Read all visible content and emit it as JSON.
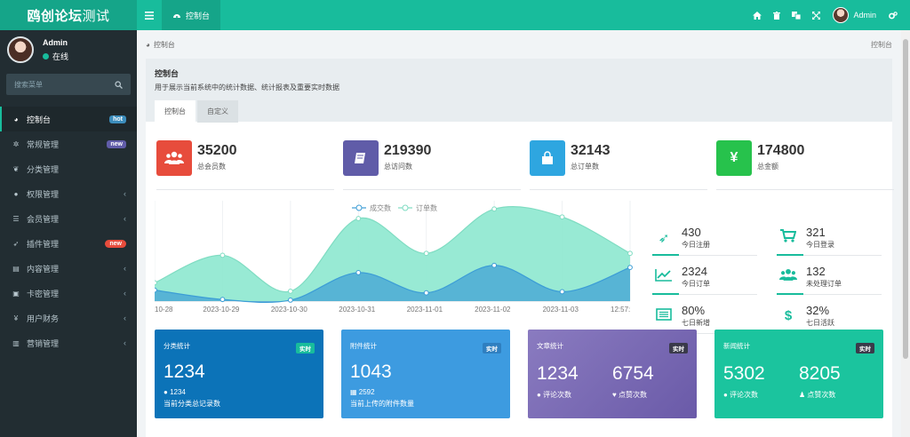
{
  "app": {
    "brand_bold": "鸥创论坛",
    "brand_thin": "测试"
  },
  "header": {
    "tab_label": "控制台",
    "user_name": "Admin",
    "icons": [
      "home-icon",
      "trash-icon",
      "translate-icon",
      "fullscreen-icon",
      "gears-icon"
    ]
  },
  "sidebar": {
    "user_name": "Admin",
    "status": "在线",
    "search_placeholder": "搜索菜单",
    "items": [
      {
        "label": "控制台",
        "icon": "dashboard-icon",
        "badge": "hot"
      },
      {
        "label": "常规管理",
        "icon": "cogs-icon",
        "badge": "new"
      },
      {
        "label": "分类管理",
        "icon": "leaf-icon"
      },
      {
        "label": "权限管理",
        "icon": "group-icon"
      },
      {
        "label": "会员管理",
        "icon": "list-icon"
      },
      {
        "label": "插件管理",
        "icon": "rocket-icon",
        "badge": "new"
      },
      {
        "label": "内容管理",
        "icon": "file-icon"
      },
      {
        "label": "卡密管理",
        "icon": "image-icon"
      },
      {
        "label": "用户财务",
        "icon": "yen-icon"
      },
      {
        "label": "营销管理",
        "icon": "bar-chart-icon"
      }
    ]
  },
  "breadcrumb": {
    "label": "控制台",
    "right": "控制台"
  },
  "panel": {
    "title": "控制台",
    "subtitle": "用于展示当前系统中的统计数据、统计报表及重要实时数据",
    "tabs": [
      "控制台",
      "自定义"
    ]
  },
  "stats": [
    {
      "value": "35200",
      "label": "总会员数",
      "color": "#e74c3c",
      "icon": "users-icon"
    },
    {
      "value": "219390",
      "label": "总访问数",
      "color": "#605ca8",
      "icon": "book-icon"
    },
    {
      "value": "32143",
      "label": "总订单数",
      "color": "#3498db",
      "icon": "shopping-bag-icon"
    },
    {
      "value": "174800",
      "label": "总金额",
      "color": "#27ae60",
      "icon": "yen-icon"
    }
  ],
  "chart_data": {
    "type": "area",
    "x": [
      "10-28",
      "2023-10-29",
      "2023-10-30",
      "2023-10-31",
      "2023-11-01",
      "2023-11-02",
      "2023-11-03",
      "12:57:"
    ],
    "series": [
      {
        "name": "成交数",
        "values": [
          68,
          10,
          6,
          176,
          51,
          221,
          58,
          208
        ]
      },
      {
        "name": "订单数",
        "values": [
          113,
          283,
          61,
          510,
          295,
          569,
          520,
          295
        ]
      }
    ],
    "ylim": [
      0,
      620
    ],
    "colors": {
      "成交数": "#3c9dd6",
      "订单数": "#8de8cf"
    }
  },
  "mini_stats": [
    {
      "value": "430",
      "label": "今日注册",
      "icon": "rocket-icon"
    },
    {
      "value": "321",
      "label": "今日登录",
      "icon": "cart-icon"
    },
    {
      "value": "2324",
      "label": "今日订单",
      "icon": "line-chart-icon"
    },
    {
      "value": "132",
      "label": "未处理订单",
      "icon": "users-icon"
    },
    {
      "value": "80%",
      "label": "七日新增",
      "icon": "list-alt-icon"
    },
    {
      "value": "32%",
      "label": "七日活跃",
      "icon": "dollar-icon"
    }
  ],
  "cards": [
    {
      "title": "分类统计",
      "tag": "实时",
      "big": "1234",
      "small": "1234",
      "note": "当前分类总记录数",
      "color": "#0c73b8"
    },
    {
      "title": "附件统计",
      "tag": "实时",
      "big": "1043",
      "small": "2592",
      "note": "当前上传的附件数量",
      "color": "#3d9be0"
    },
    {
      "title": "文章统计",
      "tag": "实时",
      "big1": "1234",
      "label1": "评论次数",
      "big2": "6754",
      "label2": "点赞次数",
      "color": "#7d6cb5"
    },
    {
      "title": "新闻统计",
      "tag": "实时",
      "big1": "5302",
      "label1": "评论次数",
      "big2": "8205",
      "label2": "点赞次数",
      "color": "#1bc49e"
    }
  ]
}
